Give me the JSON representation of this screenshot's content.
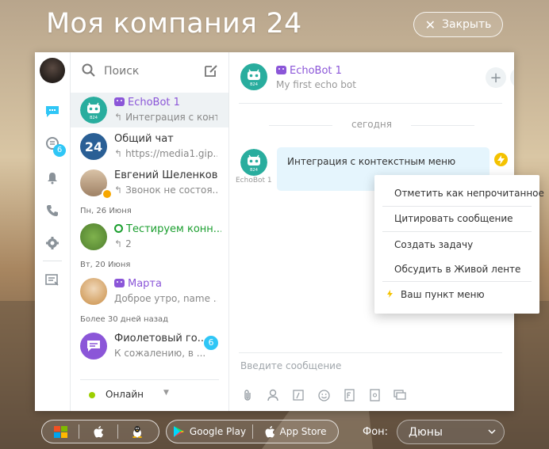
{
  "header": {
    "title": "Моя компания 24",
    "close_label": "Закрыть"
  },
  "search": {
    "placeholder": "Поиск"
  },
  "rail": {
    "tasks_badge": "6"
  },
  "recent": {
    "items": [
      {
        "name": "EchoBot 1",
        "preview": "Интеграция с контек..."
      },
      {
        "name": "Общий чат",
        "preview": "https://media1.gip..."
      },
      {
        "name": "Евгений Шеленков",
        "preview": "Звонок не состоя..."
      },
      {
        "name": "Тестируем конн...",
        "preview": "2"
      },
      {
        "name": "Марта",
        "preview": "Доброе утро, name ..."
      },
      {
        "name": "Фиолетовый го...",
        "preview": "К сожалению, в ...",
        "badge": "6"
      }
    ],
    "sections": [
      "Пн, 26 Июня",
      "Вт, 20 Июня",
      "Более 30 дней назад"
    ],
    "group_avatar_text": "24"
  },
  "status": {
    "label": "Онлайн"
  },
  "chat": {
    "title": "EchoBot 1",
    "subtitle": "My first echo bot",
    "date_separator": "сегодня",
    "message_author": "EchoBot 1",
    "message_text": "Интеграция с контекстным меню",
    "input_placeholder": "Введите сообщение"
  },
  "context_menu": {
    "items": [
      "Отметить как непрочитанное",
      "Цитировать сообщение",
      "Создать задачу",
      "Обсудить в Живой ленте",
      "Ваш пункт меню"
    ]
  },
  "bottom": {
    "google_play": "Google Play",
    "app_store": "App Store",
    "background_label": "Фон:",
    "background_value": "Дюны"
  },
  "colors": {
    "accent": "#2fc6f6",
    "bot_violet": "#8b56d8",
    "open_channel_green": "#1a9e2e",
    "bot_teal": "#29ad9e",
    "bubble": "#e5f5fd"
  }
}
